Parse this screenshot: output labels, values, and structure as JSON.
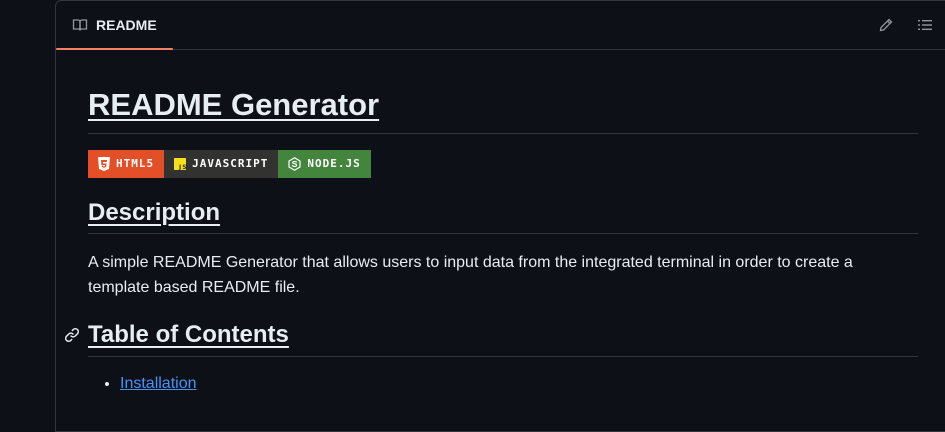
{
  "header": {
    "tab_label": "README",
    "book_icon": "book-icon",
    "edit_icon": "pencil-icon",
    "outline_icon": "list-icon"
  },
  "readme": {
    "title": "README Generator",
    "badges": [
      {
        "label": "HTML5",
        "icon": "html5-icon",
        "color": "#e34f26"
      },
      {
        "label": "JAVASCRIPT",
        "icon": "javascript-icon",
        "color": "#323330"
      },
      {
        "label": "NODE.JS",
        "icon": "nodejs-icon",
        "color": "#43853d"
      }
    ],
    "description_heading": "Description",
    "description_text": "A simple README Generator that allows users to input data from the integrated terminal in order to create a template based README file.",
    "toc_heading": "Table of Contents",
    "toc_items": [
      "Installation"
    ]
  },
  "colors": {
    "background": "#0d1117",
    "border": "#30363d",
    "text": "#e6edf3",
    "link": "#4493f8",
    "tab_underline": "#f78166"
  }
}
